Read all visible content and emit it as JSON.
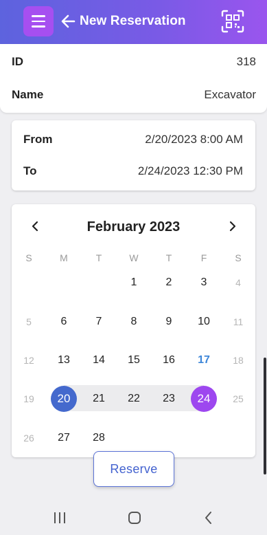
{
  "header": {
    "title": "New Reservation"
  },
  "info": {
    "id_label": "ID",
    "id_value": "318",
    "name_label": "Name",
    "name_value": "Excavator"
  },
  "dates": {
    "from_label": "From",
    "from_value": "2/20/2023 8:00 AM",
    "to_label": "To",
    "to_value": "2/24/2023 12:30 PM"
  },
  "calendar": {
    "month_title": "February 2023",
    "weekdays": [
      "S",
      "M",
      "T",
      "W",
      "T",
      "F",
      "S"
    ],
    "weeks": [
      [
        "",
        "",
        "",
        "1",
        "2",
        "3",
        "4"
      ],
      [
        "5",
        "6",
        "7",
        "8",
        "9",
        "10",
        "11"
      ],
      [
        "12",
        "13",
        "14",
        "15",
        "16",
        "17",
        "18"
      ],
      [
        "19",
        "20",
        "21",
        "22",
        "23",
        "24",
        "25"
      ],
      [
        "26",
        "27",
        "28",
        "",
        "",
        "",
        ""
      ]
    ],
    "today": "17",
    "range_start": "20",
    "range_end": "24",
    "colors": {
      "start": "#4469cd",
      "end": "#9d47ef",
      "today": "#3d86d8",
      "band": "#ececee"
    }
  },
  "actions": {
    "reserve_label": "Reserve"
  }
}
